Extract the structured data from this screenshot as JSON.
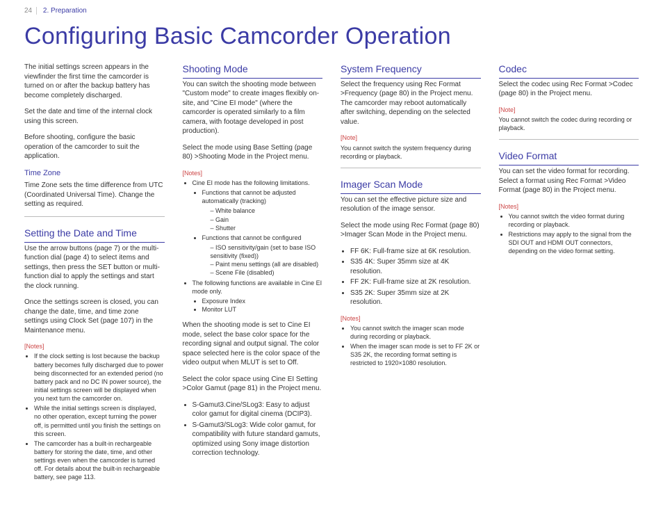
{
  "header": {
    "page_number": "24",
    "chapter": "2. Preparation"
  },
  "title": "Configuring Basic Camcorder Operation",
  "col1": {
    "intro1": "The initial settings screen appears in the viewfinder the first time the camcorder is turned on or after the backup battery has become completely discharged.",
    "intro2": "Set the date and time of the internal clock using this screen.",
    "intro3": "Before shooting, configure the basic operation of the camcorder to suit the application.",
    "tz_heading": "Time Zone",
    "tz_body": "Time Zone sets the time difference from UTC (Coordinated Universal Time). Change the setting as required.",
    "dt_heading": "Setting the Date and Time",
    "dt_body1": "Use the arrow buttons (page 7) or the multi-function dial (page 4) to select items and settings, then press the SET button or multi-function dial to apply the settings and start the clock running.",
    "dt_body2": "Once the settings screen is closed, you can change the date, time, and time zone settings using Clock Set (page 107) in the Maintenance menu.",
    "notes_label": "[Notes]",
    "notes": [
      "If the clock setting is lost because the backup battery becomes fully discharged due to power being disconnected for an extended period (no battery pack and no DC IN power source), the initial settings screen will be displayed when you next turn the camcorder on.",
      "While the initial settings screen is displayed, no other operation, except turning the power off, is permitted until you finish the settings on this screen.",
      "The camcorder has a built-in rechargeable battery for storing the date, time, and other settings even when the camcorder is turned off. For details about the built-in rechargeable battery, see page 113."
    ]
  },
  "col2": {
    "sm_heading": "Shooting Mode",
    "sm_body1": "You can switch the shooting mode between \"Custom mode\" to create images flexibly on-site, and \"Cine EI mode\" (where the camcorder is operated similarly to a film camera, with footage developed in post production).",
    "sm_body2": "Select the mode using Base Setting (page 80) >Shooting Mode in the Project menu.",
    "notes_label": "[Notes]",
    "n1": "Cine EI mode has the following limitations.",
    "n1a": "Functions that cannot be adjusted automatically (tracking)",
    "n1a_items": [
      "White balance",
      "Gain",
      "Shutter"
    ],
    "n1b": "Functions that cannot be configured",
    "n1b_items": [
      "ISO sensitivity/gain (set to base ISO sensitivity (fixed))",
      "Paint menu settings (all are disabled)",
      "Scene File (disabled)"
    ],
    "n2": "The following functions are available in Cine EI mode only.",
    "n2_items": [
      "Exposure Index",
      "Monitor LUT"
    ],
    "sm_body3": "When the shooting mode is set to Cine EI mode, select the base color space for the recording signal and output signal. The color space selected here is the color space of the video output when MLUT is set to Off.",
    "sm_body4": "Select the color space using Cine EI Setting >Color Gamut (page 81) in the Project menu.",
    "sm_list": [
      "S-Gamut3.Cine/SLog3: Easy to adjust color gamut for digital cinema (DCIP3).",
      "S-Gamut3/SLog3: Wide color gamut, for compatibility with future standard gamuts, optimized using Sony image distortion correction technology."
    ]
  },
  "col3": {
    "sf_heading": "System Frequency",
    "sf_body": "Select the frequency using Rec Format >Frequency (page 80) in the Project menu. The camcorder may reboot automatically after switching, depending on the selected value.",
    "sf_note_label": "[Note]",
    "sf_note": "You cannot switch the system frequency during recording or playback.",
    "ism_heading": "Imager Scan Mode",
    "ism_body1": "You can set the effective picture size and resolution of the image sensor.",
    "ism_body2": "Select the mode using Rec Format (page 80) >Imager Scan Mode in the Project menu.",
    "ism_list": [
      "FF 6K: Full-frame size at 6K resolution.",
      "S35 4K: Super 35mm size at 4K resolution.",
      "FF 2K: Full-frame size at 2K resolution.",
      "S35 2K: Super 35mm size at 2K resolution."
    ],
    "ism_notes_label": "[Notes]",
    "ism_notes": [
      "You cannot switch the imager scan mode during recording or playback.",
      "When the imager scan mode is set to FF 2K or S35 2K, the recording format setting is restricted to 1920×1080 resolution."
    ]
  },
  "col4": {
    "codec_heading": "Codec",
    "codec_body": "Select the codec using Rec Format >Codec (page 80) in the Project menu.",
    "codec_note_label": "[Note]",
    "codec_note": "You cannot switch the codec during recording or playback.",
    "vf_heading": "Video Format",
    "vf_body1": "You can set the video format for recording. Select a format using Rec Format >Video Format (page 80) in the Project menu.",
    "vf_notes_label": "[Notes]",
    "vf_notes": [
      "You cannot switch the video format during recording or playback.",
      "Restrictions may apply to the signal from the SDI OUT and HDMI OUT connectors, depending on the video format setting."
    ]
  }
}
